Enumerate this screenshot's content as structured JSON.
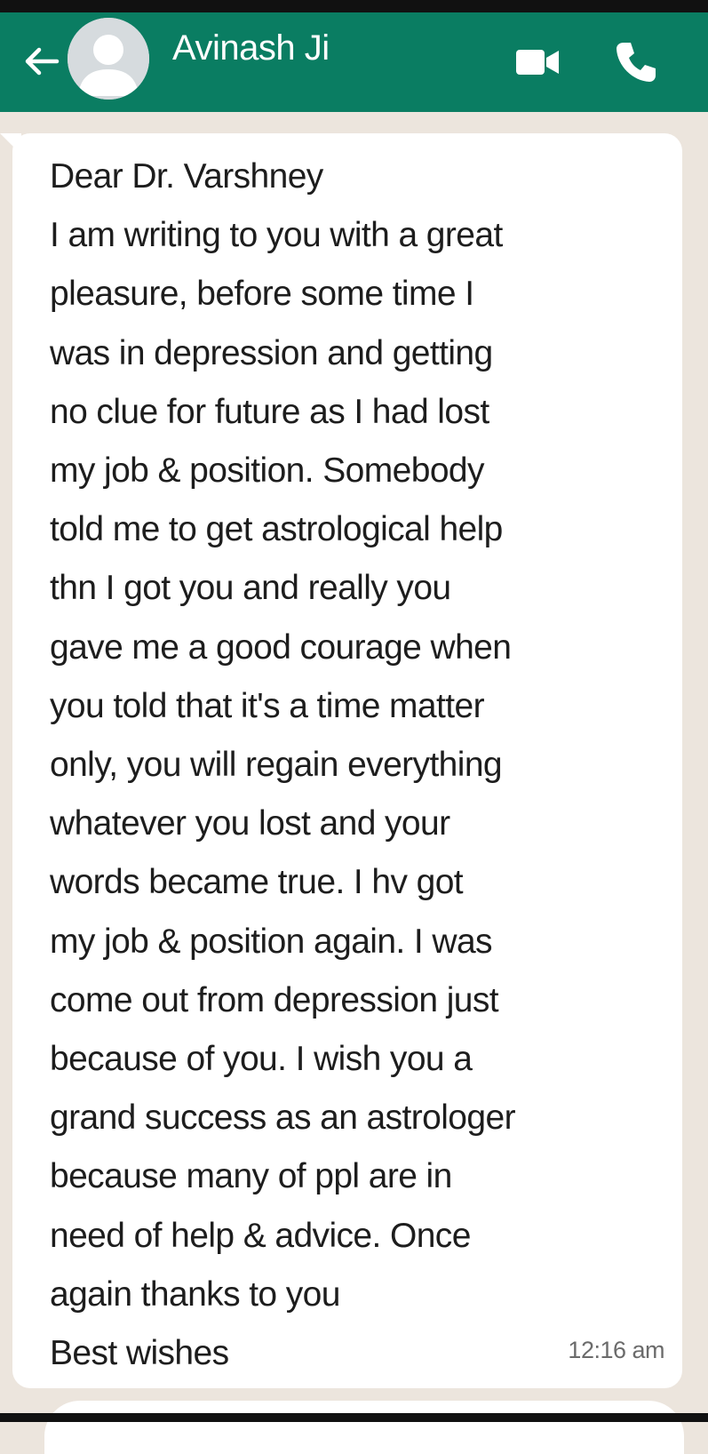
{
  "header": {
    "contact_name": "Avinash Ji",
    "back_icon": "arrow-left-icon",
    "video_icon": "video-camera-icon",
    "call_icon": "phone-icon",
    "colors": {
      "header_bg": "#0a7d62",
      "chat_bg": "#ece5dd",
      "bubble_bg": "#ffffff"
    }
  },
  "message": {
    "lines": [
      "Dear Dr. Varshney",
      "I am writing to you with a great",
      "pleasure, before some time I",
      "was in depression and getting",
      "no clue for future as I had lost",
      "my job & position. Somebody",
      "told me to get astrological help",
      "thn I got you and really you",
      "gave me a good courage when",
      "you told that it's a time matter",
      "only, you will regain everything",
      "whatever you lost and your",
      "words became true. I hv got",
      "my job & position again. I was",
      "come out from depression just",
      "because of you. I wish you a",
      "grand success as an astrologer",
      "because  many of ppl are in",
      "need of help & advice. Once",
      "again thanks to you",
      "Best wishes"
    ],
    "time": "12:16 am"
  }
}
